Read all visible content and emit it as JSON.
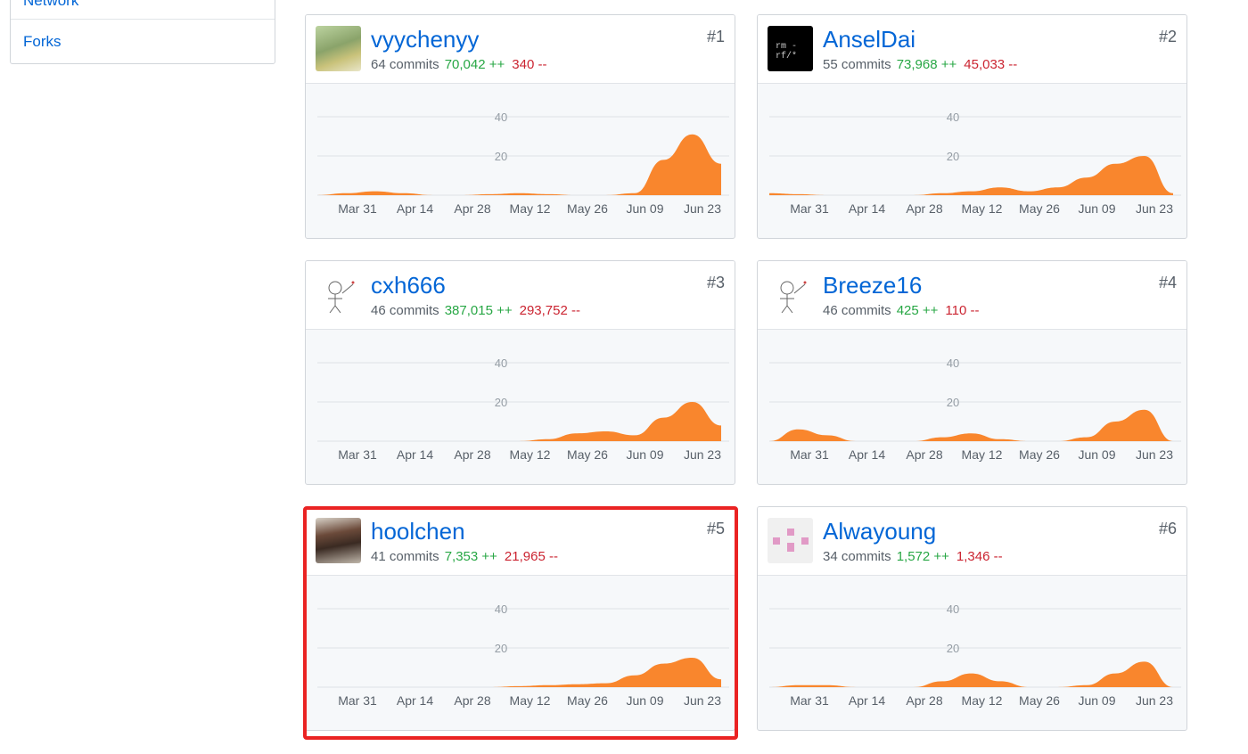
{
  "sidebar": {
    "items": [
      {
        "label": "Network"
      },
      {
        "label": "Forks"
      }
    ]
  },
  "colors": {
    "link": "#0366d6",
    "additions": "#28a745",
    "deletions": "#cb2431",
    "area": "#f9862d",
    "highlight": "#ea2323"
  },
  "chart_axis": {
    "y_ticks": [
      0,
      20,
      40
    ],
    "ylim": [
      0,
      40
    ],
    "x_ticks": [
      "Mar 31",
      "Apr 14",
      "Apr 28",
      "May 12",
      "May 26",
      "Jun 09",
      "Jun 23"
    ]
  },
  "contributors": [
    {
      "rank": "#1",
      "login": "vyychenyy",
      "commits": "64 commits",
      "additions": "70,042 ++",
      "deletions": "340 --",
      "avatar_icon": "photo-avatar-icon"
    },
    {
      "rank": "#2",
      "login": "AnselDai",
      "commits": "55 commits",
      "additions": "73,968 ++",
      "deletions": "45,033 --",
      "avatar_icon": "terminal-avatar-icon",
      "avatar_text": "rm -rf/*"
    },
    {
      "rank": "#3",
      "login": "cxh666",
      "commits": "46 commits",
      "additions": "387,015 ++",
      "deletions": "293,752 --",
      "avatar_icon": "sketch-avatar-icon"
    },
    {
      "rank": "#4",
      "login": "Breeze16",
      "commits": "46 commits",
      "additions": "425 ++",
      "deletions": "110 --",
      "avatar_icon": "sketch-avatar-icon"
    },
    {
      "rank": "#5",
      "login": "hoolchen",
      "commits": "41 commits",
      "additions": "7,353 ++",
      "deletions": "21,965 --",
      "avatar_icon": "photo-avatar-icon"
    },
    {
      "rank": "#6",
      "login": "Alwayoung",
      "commits": "34 commits",
      "additions": "1,572 ++",
      "deletions": "1,346 --",
      "avatar_icon": "identicon-avatar-icon"
    }
  ],
  "chart_data": [
    {
      "type": "area",
      "x": [
        "Mar 24",
        "Mar 31",
        "Apr 07",
        "Apr 14",
        "Apr 21",
        "Apr 28",
        "May 05",
        "May 12",
        "May 19",
        "May 26",
        "Jun 02",
        "Jun 09",
        "Jun 16",
        "Jun 23",
        "Jun 27"
      ],
      "series": [
        {
          "values": [
            0,
            1,
            2,
            1,
            0,
            0,
            0.5,
            1,
            0.5,
            0,
            0,
            1,
            18,
            31,
            16
          ]
        }
      ],
      "ylim": [
        0,
        40
      ]
    },
    {
      "type": "area",
      "x": [
        "Mar 24",
        "Mar 31",
        "Apr 07",
        "Apr 14",
        "Apr 21",
        "Apr 28",
        "May 05",
        "May 12",
        "May 19",
        "May 26",
        "Jun 02",
        "Jun 09",
        "Jun 16",
        "Jun 23",
        "Jun 27"
      ],
      "series": [
        {
          "values": [
            1,
            0.5,
            0,
            0,
            0,
            0,
            1,
            2,
            4,
            2,
            4,
            9,
            16,
            20,
            1
          ]
        }
      ],
      "ylim": [
        0,
        40
      ]
    },
    {
      "type": "area",
      "x": [
        "Mar 24",
        "Mar 31",
        "Apr 07",
        "Apr 14",
        "Apr 21",
        "Apr 28",
        "May 05",
        "May 12",
        "May 19",
        "May 26",
        "Jun 02",
        "Jun 09",
        "Jun 16",
        "Jun 23",
        "Jun 27"
      ],
      "series": [
        {
          "values": [
            0,
            0,
            0,
            0,
            0,
            0,
            0,
            0,
            1,
            4,
            5,
            3,
            12,
            20,
            8
          ]
        }
      ],
      "ylim": [
        0,
        40
      ]
    },
    {
      "type": "area",
      "x": [
        "Mar 24",
        "Mar 31",
        "Apr 07",
        "Apr 14",
        "Apr 21",
        "Apr 28",
        "May 05",
        "May 12",
        "May 19",
        "May 26",
        "Jun 02",
        "Jun 09",
        "Jun 16",
        "Jun 23",
        "Jun 27"
      ],
      "series": [
        {
          "values": [
            0,
            6,
            3,
            0,
            0,
            0,
            2,
            4,
            1,
            0,
            0,
            2,
            10,
            16,
            0
          ]
        }
      ],
      "ylim": [
        0,
        40
      ]
    },
    {
      "type": "area",
      "x": [
        "Mar 24",
        "Mar 31",
        "Apr 07",
        "Apr 14",
        "Apr 21",
        "Apr 28",
        "May 05",
        "May 12",
        "May 19",
        "May 26",
        "Jun 02",
        "Jun 09",
        "Jun 16",
        "Jun 23",
        "Jun 27"
      ],
      "series": [
        {
          "values": [
            0,
            0,
            0,
            0,
            0,
            0,
            0,
            0.5,
            1,
            1.5,
            2,
            6,
            12,
            15,
            4
          ]
        }
      ],
      "ylim": [
        0,
        40
      ]
    },
    {
      "type": "area",
      "x": [
        "Mar 24",
        "Mar 31",
        "Apr 07",
        "Apr 14",
        "Apr 21",
        "Apr 28",
        "May 05",
        "May 12",
        "May 19",
        "May 26",
        "Jun 02",
        "Jun 09",
        "Jun 16",
        "Jun 23",
        "Jun 27"
      ],
      "series": [
        {
          "values": [
            0,
            1,
            1,
            0,
            0,
            0,
            3,
            7,
            3,
            0,
            0,
            1,
            7,
            13,
            0
          ]
        }
      ],
      "ylim": [
        0,
        40
      ]
    }
  ]
}
